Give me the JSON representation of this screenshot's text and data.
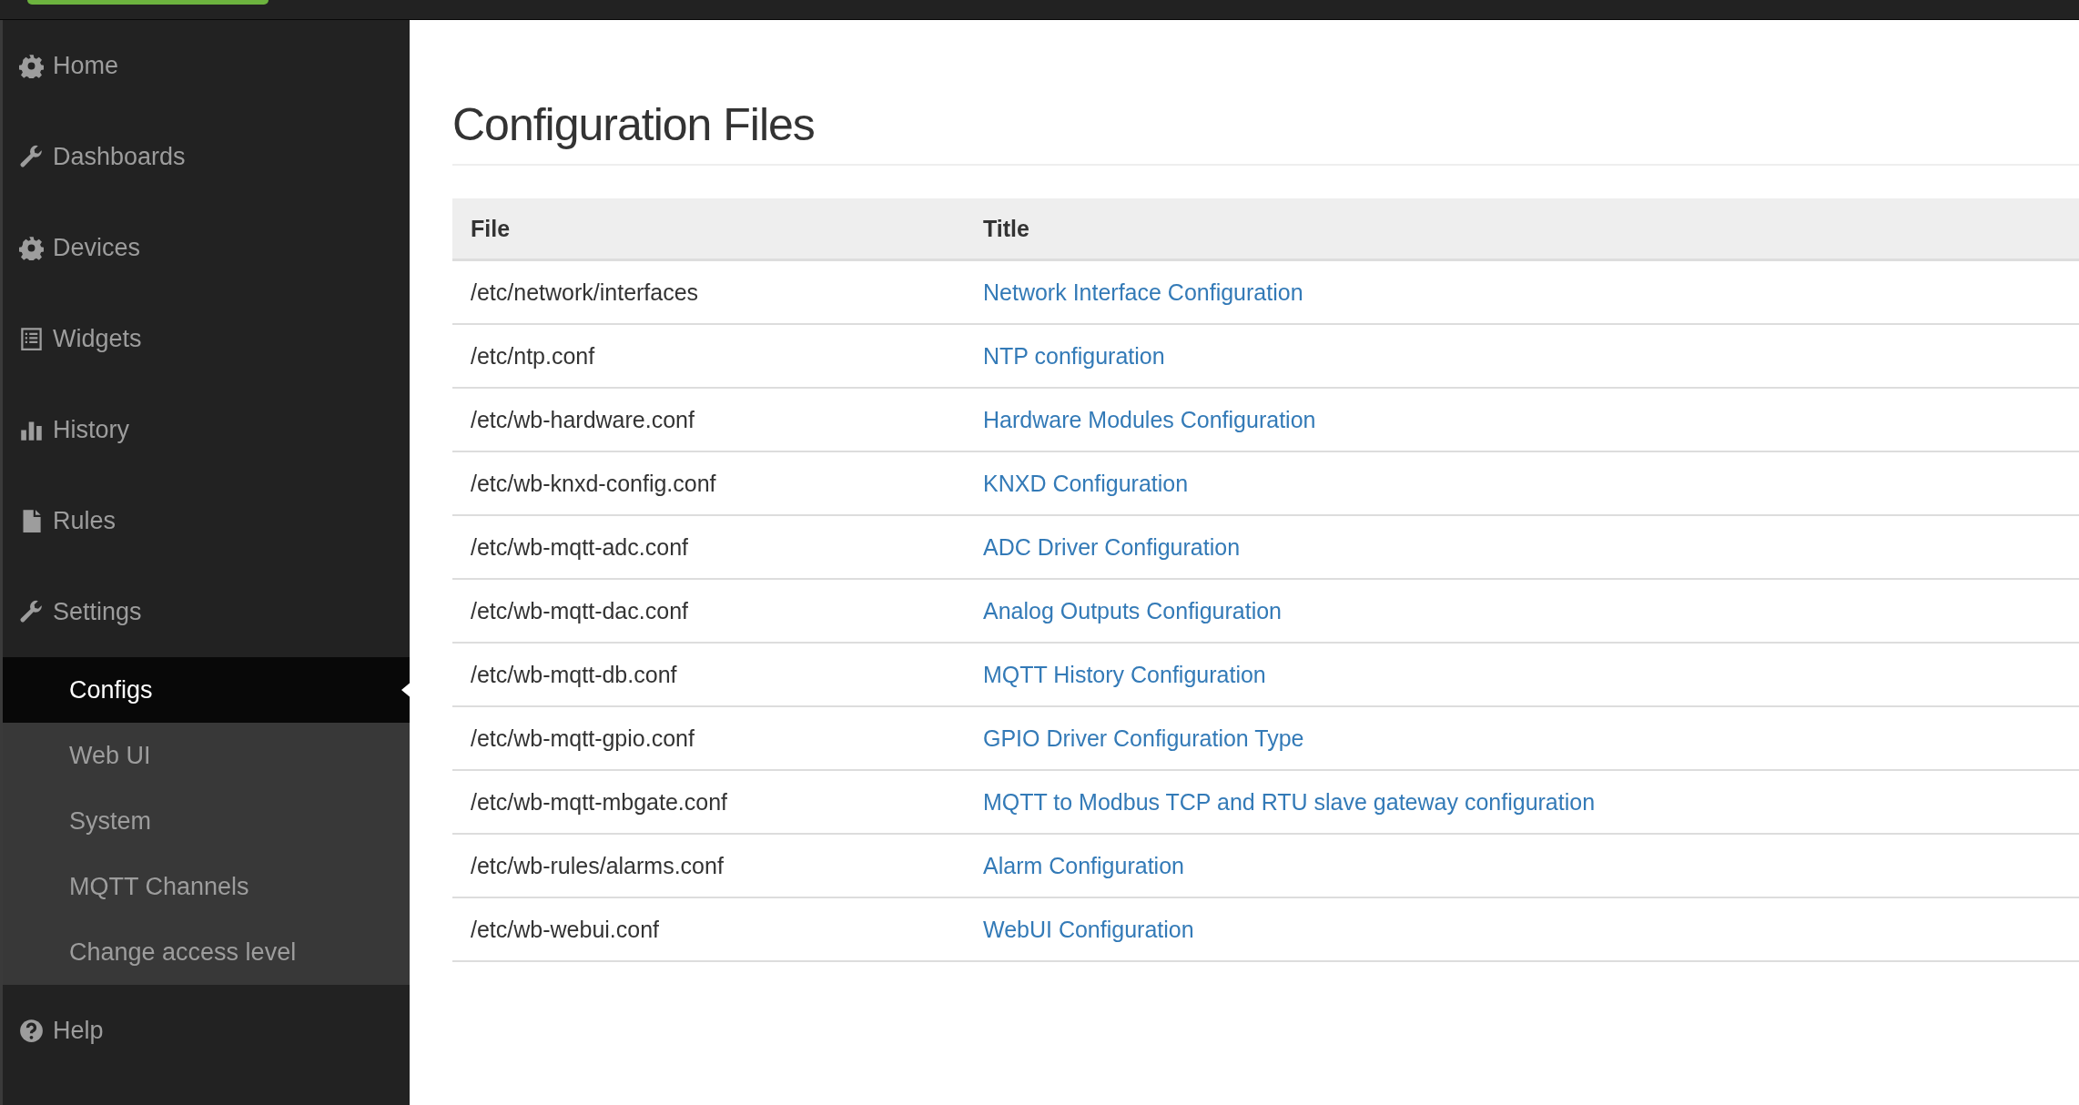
{
  "sidebar": {
    "items": [
      {
        "label": "Home",
        "selected": false
      },
      {
        "label": "Dashboards",
        "selected": false
      },
      {
        "label": "Devices",
        "selected": false
      },
      {
        "label": "Widgets",
        "selected": false
      },
      {
        "label": "History",
        "selected": false
      },
      {
        "label": "Rules",
        "selected": false
      },
      {
        "label": "Settings",
        "selected": false,
        "children": [
          {
            "label": "Configs",
            "selected": true
          },
          {
            "label": "Web UI",
            "selected": false
          },
          {
            "label": "System",
            "selected": false
          },
          {
            "label": "MQTT Channels",
            "selected": false
          },
          {
            "label": "Change access level",
            "selected": false
          }
        ]
      },
      {
        "label": "Help",
        "selected": false
      }
    ]
  },
  "page": {
    "title": "Configuration Files"
  },
  "table": {
    "columns": [
      "File",
      "Title"
    ],
    "rows": [
      {
        "file": "/etc/network/interfaces",
        "title": "Network Interface Configuration"
      },
      {
        "file": "/etc/ntp.conf",
        "title": "NTP configuration"
      },
      {
        "file": "/etc/wb-hardware.conf",
        "title": "Hardware Modules Configuration"
      },
      {
        "file": "/etc/wb-knxd-config.conf",
        "title": "KNXD Configuration"
      },
      {
        "file": "/etc/wb-mqtt-adc.conf",
        "title": "ADC Driver Configuration"
      },
      {
        "file": "/etc/wb-mqtt-dac.conf",
        "title": "Analog Outputs Configuration"
      },
      {
        "file": "/etc/wb-mqtt-db.conf",
        "title": "MQTT History Configuration"
      },
      {
        "file": "/etc/wb-mqtt-gpio.conf",
        "title": "GPIO Driver Configuration Type"
      },
      {
        "file": "/etc/wb-mqtt-mbgate.conf",
        "title": "MQTT to Modbus TCP and RTU slave gateway configuration"
      },
      {
        "file": "/etc/wb-rules/alarms.conf",
        "title": "Alarm Configuration"
      },
      {
        "file": "/etc/wb-webui.conf",
        "title": "WebUI Configuration"
      }
    ]
  }
}
